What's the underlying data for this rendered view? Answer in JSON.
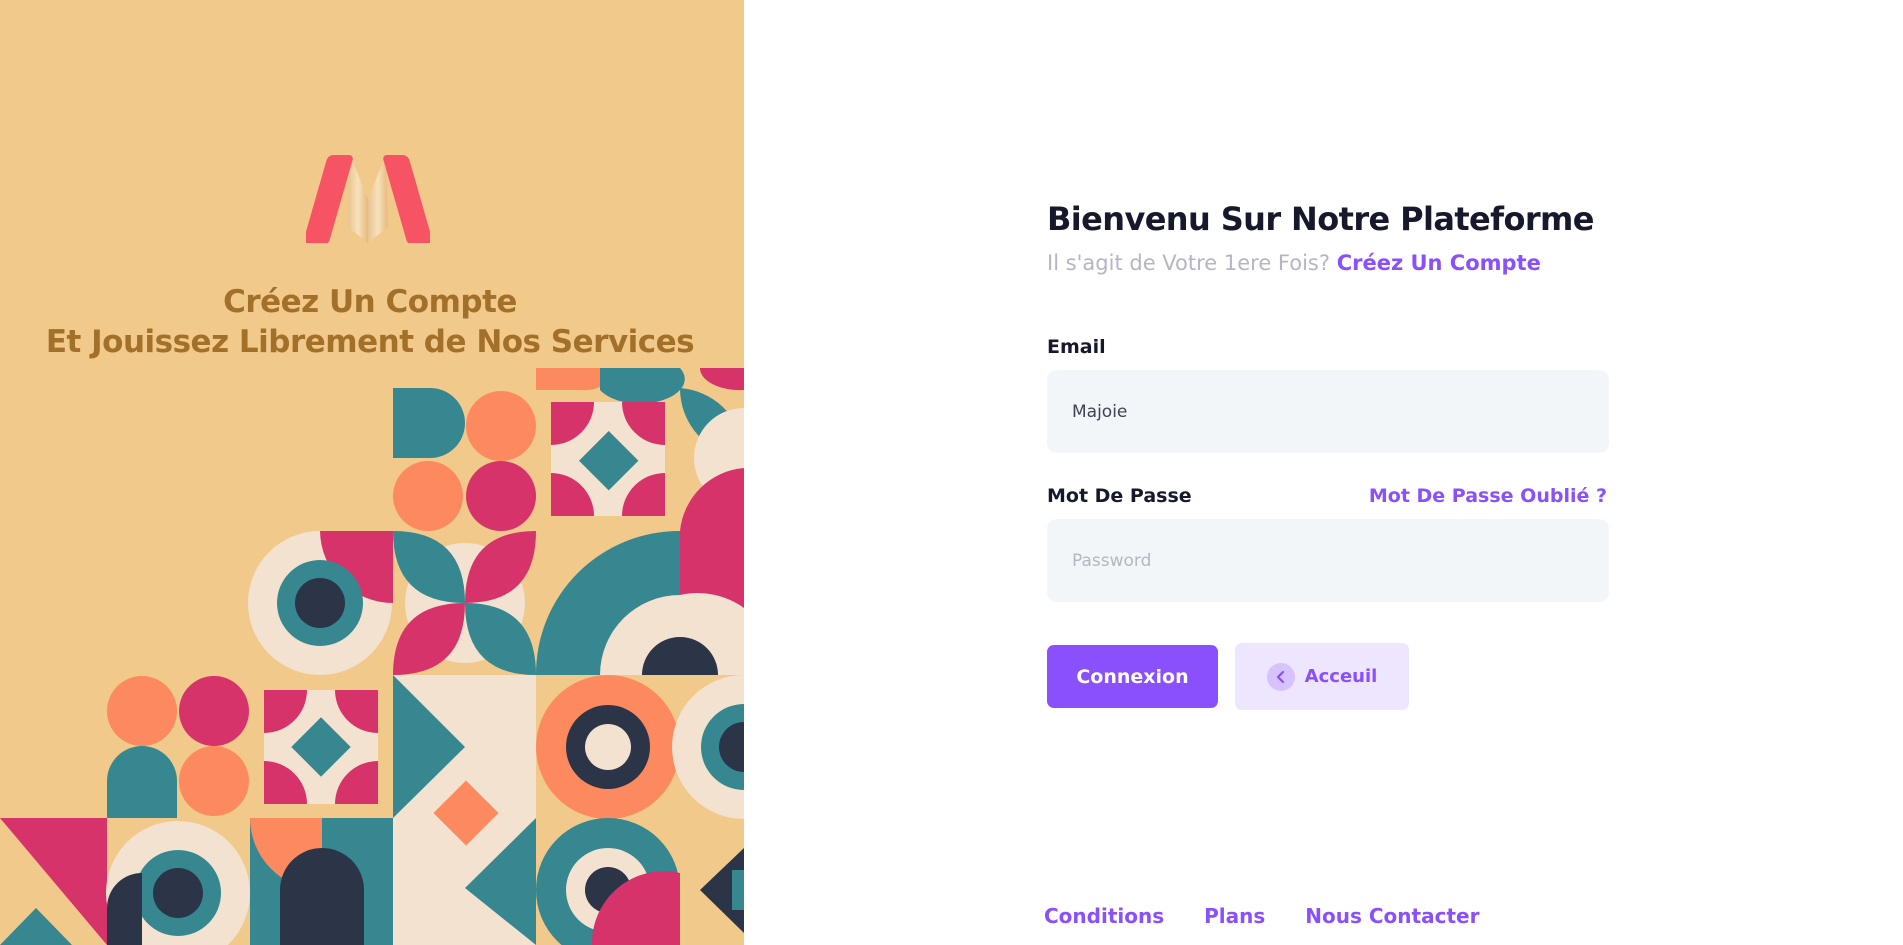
{
  "aside": {
    "tagline_line1": "Créez Un Compte",
    "tagline_line2": "Et Jouissez Librement de Nos Services"
  },
  "form": {
    "title": "Bienvenu Sur Notre Plateforme",
    "subtitle_text": "Il s'agit de Votre 1ere Fois? ",
    "signup_link": "Créez Un Compte",
    "email_label": "Email",
    "email_value": "Majoie",
    "password_label": "Mot De Passe",
    "forgot_link": "Mot De Passe Oublié ?",
    "password_placeholder": "Password",
    "submit_label": "Connexion",
    "home_label": "Acceuil"
  },
  "footer": {
    "links": [
      "Conditions",
      "Plans",
      "Nous Contacter"
    ]
  },
  "colors": {
    "primary": "#8950fc",
    "primary_light": "#eee5ff",
    "aside_bg": "#f1c98b",
    "tagline": "#a3702a",
    "logo": "#f65464",
    "pattern_teal": "#368790",
    "pattern_pink": "#d6336b",
    "pattern_orange": "#fc8a5e",
    "pattern_cream": "#f3e2d0",
    "pattern_navy": "#2c3448"
  }
}
